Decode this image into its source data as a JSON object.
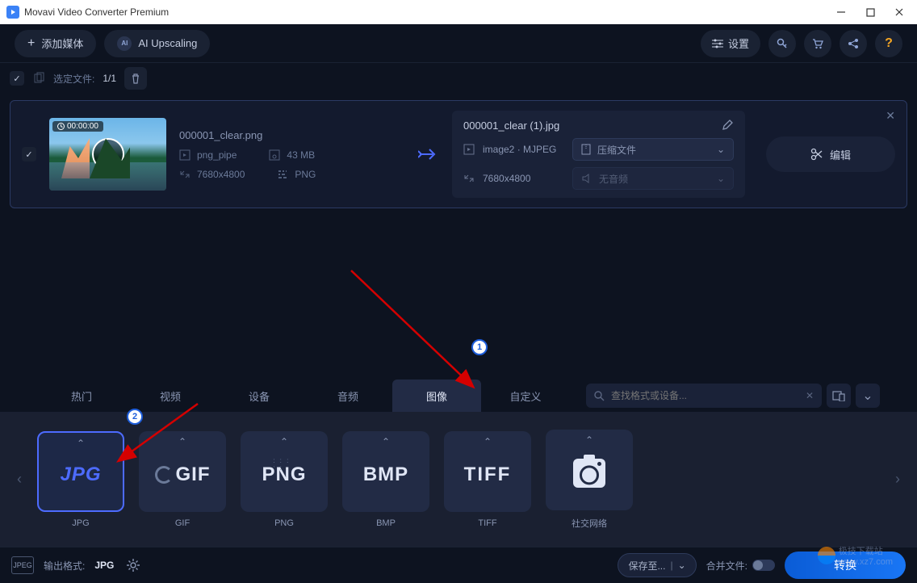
{
  "titlebar": {
    "title": "Movavi Video Converter Premium"
  },
  "toolbar": {
    "add_media": "添加媒体",
    "ai_upscaling": "AI Upscaling",
    "settings": "设置"
  },
  "selbar": {
    "selected_label": "选定文件:",
    "count": "1/1"
  },
  "file": {
    "duration": "00:00:00",
    "name": "000001_clear.png",
    "src_container": "png_pipe",
    "src_size": "43 MB",
    "src_resolution": "7680x4800",
    "src_codec": "PNG",
    "dst_name": "000001_clear (1).jpg",
    "dst_container": "image2 · MJPEG",
    "dst_compress": "压缩文件",
    "dst_resolution": "7680x4800",
    "dst_audio": "无音频",
    "edit_label": "编辑"
  },
  "tabs": {
    "hot": "热门",
    "video": "视频",
    "device": "设备",
    "audio": "音频",
    "image": "图像",
    "custom": "自定义"
  },
  "search": {
    "placeholder": "查找格式或设备..."
  },
  "formats": {
    "jpg": {
      "logo": "JPG",
      "caption": "JPG"
    },
    "gif": {
      "logo": "GIF",
      "caption": "GIF"
    },
    "png": {
      "logo": "PNG",
      "caption": "PNG"
    },
    "bmp": {
      "logo": "BMP",
      "caption": "BMP"
    },
    "tiff": {
      "logo": "TIFF",
      "caption": "TIFF"
    },
    "social": {
      "caption": "社交网络"
    }
  },
  "bottombar": {
    "out_icon": "JPEG",
    "out_label": "输出格式:",
    "out_value": "JPG",
    "save_to": "保存至...",
    "merge": "合并文件:",
    "convert": "转换"
  },
  "watermark": {
    "text1": "极技下载站",
    "text2": "www.xz7.com"
  },
  "annotations": {
    "n1": "1",
    "n2": "2"
  }
}
